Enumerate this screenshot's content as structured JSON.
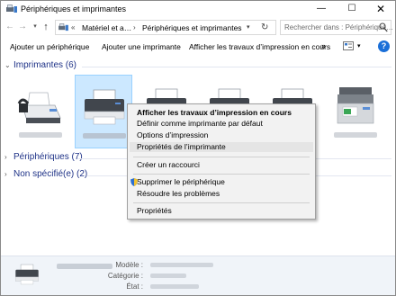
{
  "window": {
    "title": "Périphériques et imprimantes",
    "minimize": "—",
    "maximize": "☐",
    "close": "✕"
  },
  "address": {
    "back": "←",
    "forward": "→",
    "recent": "▾",
    "up": "↑",
    "sep0": "«",
    "crumbs": [
      "Matériel et a…",
      "Périphériques et imprimantes"
    ],
    "sep": "›",
    "dropdown": "▾",
    "refresh": "↻",
    "search_placeholder": "Rechercher dans : Périphérique…"
  },
  "commands": {
    "add_device": "Ajouter un périphérique",
    "add_printer": "Ajouter une imprimante",
    "show_jobs": "Afficher les travaux d’impression en cours",
    "more": "»",
    "view_drop": "▾",
    "help": "?"
  },
  "groups": {
    "printers": {
      "chevron": "⌄",
      "label": "Imprimantes (6)"
    },
    "peripherals": {
      "chevron": "›",
      "label": "Périphériques (7)"
    },
    "unspecified": {
      "chevron": "›",
      "label": "Non spécifié(e) (2)"
    }
  },
  "printer_icons": [
    "fax-icon",
    "printer-icon",
    "printer-icon",
    "printer-icon",
    "printer-icon",
    "multifunction-printer-icon"
  ],
  "context_menu": {
    "items": [
      "Afficher les travaux d’impression en cours",
      "Définir comme imprimante par défaut",
      "Options d’impression",
      "Propriétés de l’imprimante",
      "Créer un raccourci",
      "Supprimer le périphérique",
      "Résoudre les problèmes",
      "Propriétés"
    ]
  },
  "details": {
    "model_label": "Modèle :",
    "category_label": "Catégorie :",
    "state_label": "État :"
  },
  "colors": {
    "selection": "#cce8ff",
    "group_header": "#1e3287",
    "details_bg": "#f0f4f9",
    "help": "#1a6fd8"
  }
}
